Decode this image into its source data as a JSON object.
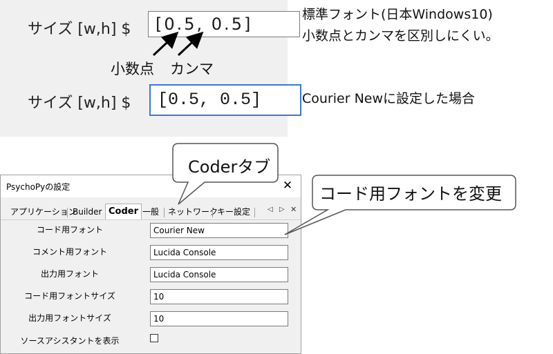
{
  "comparison": {
    "row1": {
      "label": "サイズ [w,h] $",
      "value": "[0.5, 0.5]"
    },
    "row2": {
      "label": "サイズ [w,h] $",
      "value": "[0.5, 0.5]"
    },
    "annotations": {
      "decimal_point": "小数点",
      "comma": "カンマ"
    }
  },
  "notes": {
    "default_font_line1": "標準フォント(日本Windows10)",
    "default_font_line2": "小数点とカンマを区別しにくい。",
    "courier_note": "Courier Newに設定した場合"
  },
  "callouts": {
    "coder_tab": "Coderタブ",
    "change_font": "コード用フォントを変更"
  },
  "dialog": {
    "title": "PsychoPyの設定",
    "tabs": [
      {
        "label": "アプリケーション"
      },
      {
        "label": "Builder"
      },
      {
        "label": "Coder"
      },
      {
        "label": "一般"
      },
      {
        "label": "ネットワーク"
      },
      {
        "label": "キー設定"
      }
    ],
    "active_tab": "Coder",
    "fields": [
      {
        "label": "コード用フォント",
        "value": "Courier New"
      },
      {
        "label": "コメント用フォント",
        "value": "Lucida Console"
      },
      {
        "label": "出力用フォント",
        "value": "Lucida Console"
      },
      {
        "label": "コード用フォントサイズ",
        "value": "10"
      },
      {
        "label": "出力用フォントサイズ",
        "value": "10"
      }
    ],
    "checkbox_field": {
      "label": "ソースアシスタントを表示",
      "checked": false
    }
  },
  "colors": {
    "focus_border": "#3a78d4",
    "panel_bg": "#f0f0f0"
  },
  "icons": [
    "close-icon",
    "tab-prev-icon",
    "tab-next-icon",
    "tab-close-icon",
    "arrow-icon"
  ]
}
